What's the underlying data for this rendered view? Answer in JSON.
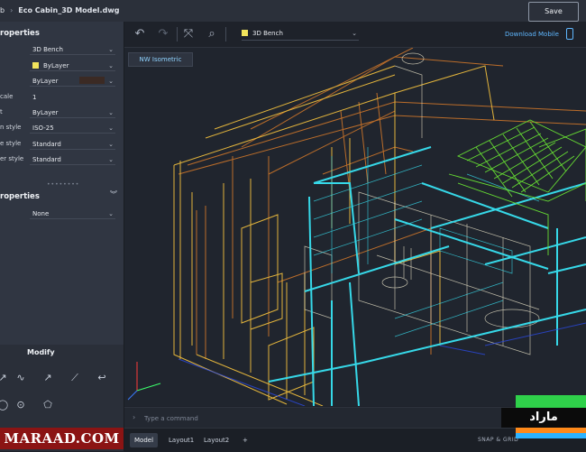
{
  "titlebar": {
    "crumb_parent": "b",
    "file_name": "Eco Cabin_3D Model.dwg",
    "save_label": "Save"
  },
  "left_panel": {
    "section1_title": "roperties",
    "props": [
      {
        "label": "",
        "value": "3D Bench"
      },
      {
        "label": "",
        "value": "ByLayer",
        "swatch": "#f2e45c"
      },
      {
        "label": "",
        "value": "ByLayer",
        "swatch": "#3b2a24"
      },
      {
        "label": "cale",
        "value": "1"
      },
      {
        "label": "t",
        "value": "ByLayer"
      },
      {
        "label": "n style",
        "value": "ISO-25"
      },
      {
        "label": "e style",
        "value": "Standard"
      },
      {
        "label": "er style",
        "value": "Standard"
      }
    ],
    "section2_title": "roperties",
    "props2": [
      {
        "label": "",
        "value": "None"
      }
    ],
    "modify_title": "Modify",
    "tools": [
      "move-icon",
      "polyline-icon",
      "arrow-icon",
      "line-icon",
      "undo-curve-icon",
      "circle-icon",
      "ellipse-icon",
      "polygon-icon"
    ]
  },
  "watermark_left": "MARAAD.COM",
  "toolbar": {
    "layer_name": "3D Bench",
    "layer_color": "#f2e45c",
    "download_label": "Download Mobile"
  },
  "viewport": {
    "view_name": "NW Isometric"
  },
  "command": {
    "placeholder": "Type a command"
  },
  "tabs": [
    {
      "label": "Model",
      "active": true
    },
    {
      "label": "Layout1",
      "active": false
    },
    {
      "label": "Layout2",
      "active": false
    }
  ],
  "add_tab": "+",
  "status": {
    "snap": "SNAP & GRID"
  },
  "logo_text": "ماراد",
  "colors": {
    "accent": "#5fb7ff",
    "wire_yellow": "#e2b43c",
    "wire_cyan": "#36d8e8",
    "wire_green": "#66dd33",
    "wire_orange": "#d77a2a"
  }
}
